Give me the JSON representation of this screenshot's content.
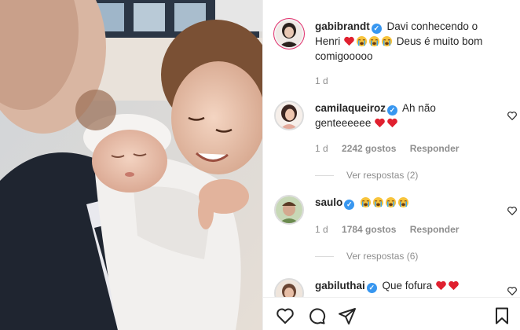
{
  "post": {
    "author": "gabibrandt",
    "caption_start": "Davi conhecendo o Henri",
    "caption_end": "Deus é muito bom comigooooo",
    "time": "1 d"
  },
  "comments": [
    {
      "username": "camilaqueiroz",
      "text": "Ah não genteeeeee",
      "time": "1 d",
      "likes": "2242 gostos",
      "reply": "Responder",
      "view_replies": "Ver respostas (2)"
    },
    {
      "username": "saulo",
      "text": "",
      "time": "1 d",
      "likes": "1784 gostos",
      "reply": "Responder",
      "view_replies": "Ver respostas (6)"
    },
    {
      "username": "gabiluthai",
      "text": "Que fofura"
    }
  ],
  "icons": {
    "like": "heart-icon",
    "comment": "comment-icon",
    "share": "paper-plane-icon",
    "save": "bookmark-icon",
    "verified": "verified-badge-icon",
    "emoji_heart": "red-heart-emoji",
    "emoji_cry": "loudly-crying-face-emoji"
  },
  "colors": {
    "verified": "#3897f0",
    "meta_text": "#8e8e8e",
    "heart_red": "#e0202f"
  }
}
